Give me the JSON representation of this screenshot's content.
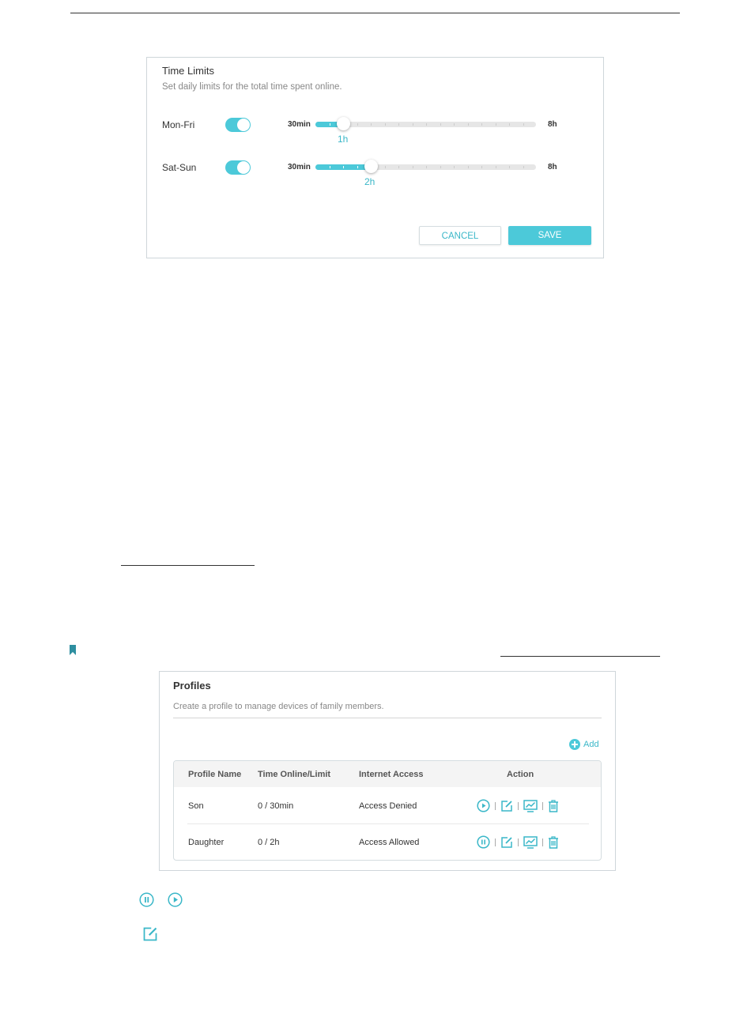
{
  "time_limits": {
    "title": "Time Limits",
    "description": "Set daily limits for the total time spent online.",
    "rows": [
      {
        "label": "Mon-Fri",
        "enabled": true,
        "min_label": "30min",
        "max_label": "8h",
        "value_label": "1h"
      },
      {
        "label": "Sat-Sun",
        "enabled": true,
        "min_label": "30min",
        "max_label": "8h",
        "value_label": "2h"
      }
    ],
    "cancel_label": "CANCEL",
    "save_label": "SAVE",
    "accent_color": "#4cc9d9"
  },
  "profiles": {
    "title": "Profiles",
    "description": "Create a profile to manage devices of family members.",
    "add_label": "Add",
    "columns": [
      "Profile Name",
      "Time Online/Limit",
      "Internet Access",
      "Action"
    ],
    "rows": [
      {
        "name": "Son",
        "time": "0 / 30min",
        "access": "Access Denied",
        "actions": [
          "play-icon",
          "edit-icon",
          "chart-icon",
          "trash-icon"
        ]
      },
      {
        "name": "Daughter",
        "time": "0 / 2h",
        "access": "Access Allowed",
        "actions": [
          "pause-icon",
          "edit-icon",
          "chart-icon",
          "trash-icon"
        ]
      }
    ]
  },
  "legend_icons": [
    "pause-icon",
    "play-icon",
    "edit-icon"
  ]
}
